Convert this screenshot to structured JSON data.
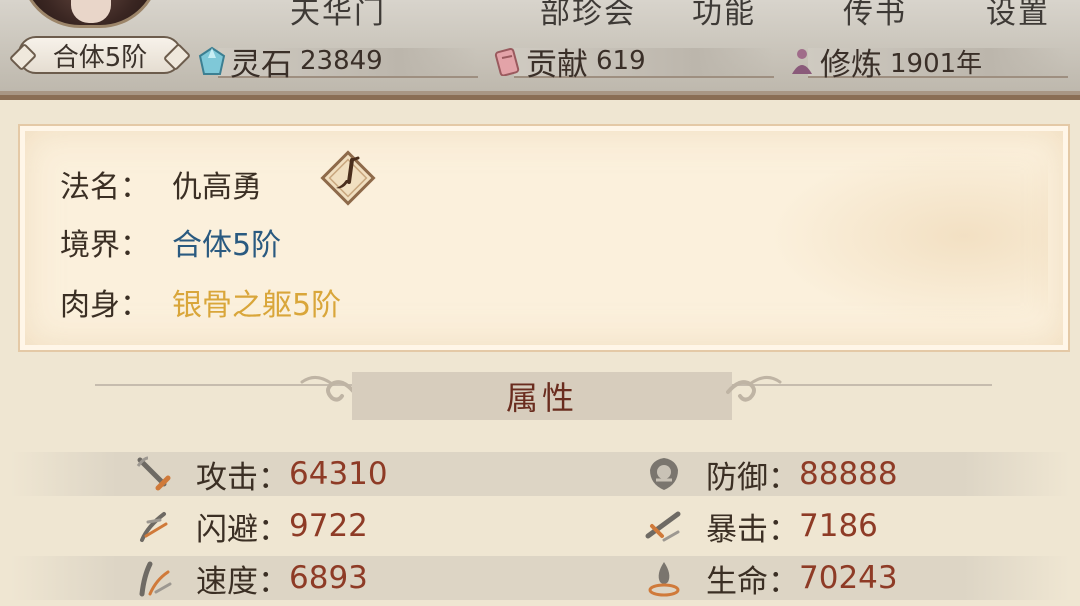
{
  "header": {
    "sect_name": "天华门",
    "nav": [
      "部珍会",
      "功能",
      "传书",
      "设置"
    ],
    "realm_badge": "合体5阶",
    "resources": [
      {
        "name": "灵石",
        "value": "23849",
        "icon": "spirit-stone-icon"
      },
      {
        "name": "贡献",
        "value": "619",
        "icon": "contribution-icon"
      },
      {
        "name": "修炼",
        "value": "1901年",
        "icon": "cultivation-icon"
      }
    ]
  },
  "profile": {
    "name_label": "法名：",
    "name": "仇高勇",
    "realm_label": "境界：",
    "realm": "合体5阶",
    "body_label": "肉身：",
    "body": "银骨之躯5阶"
  },
  "attributes": {
    "title": "属性",
    "stats": [
      {
        "label": "攻击：",
        "value": "64310",
        "icon": "attack-icon"
      },
      {
        "label": "防御：",
        "value": "88888",
        "icon": "defense-icon"
      },
      {
        "label": "闪避：",
        "value": "9722",
        "icon": "dodge-icon"
      },
      {
        "label": "暴击：",
        "value": "7186",
        "icon": "crit-icon"
      },
      {
        "label": "速度：",
        "value": "6893",
        "icon": "speed-icon"
      },
      {
        "label": "生命：",
        "value": "70243",
        "icon": "life-icon"
      }
    ]
  },
  "colors": {
    "realm_text": "#2a5a80",
    "body_text": "#d9a63a",
    "stat_value": "#8e3b26",
    "attr_title": "#6a2c1e"
  }
}
